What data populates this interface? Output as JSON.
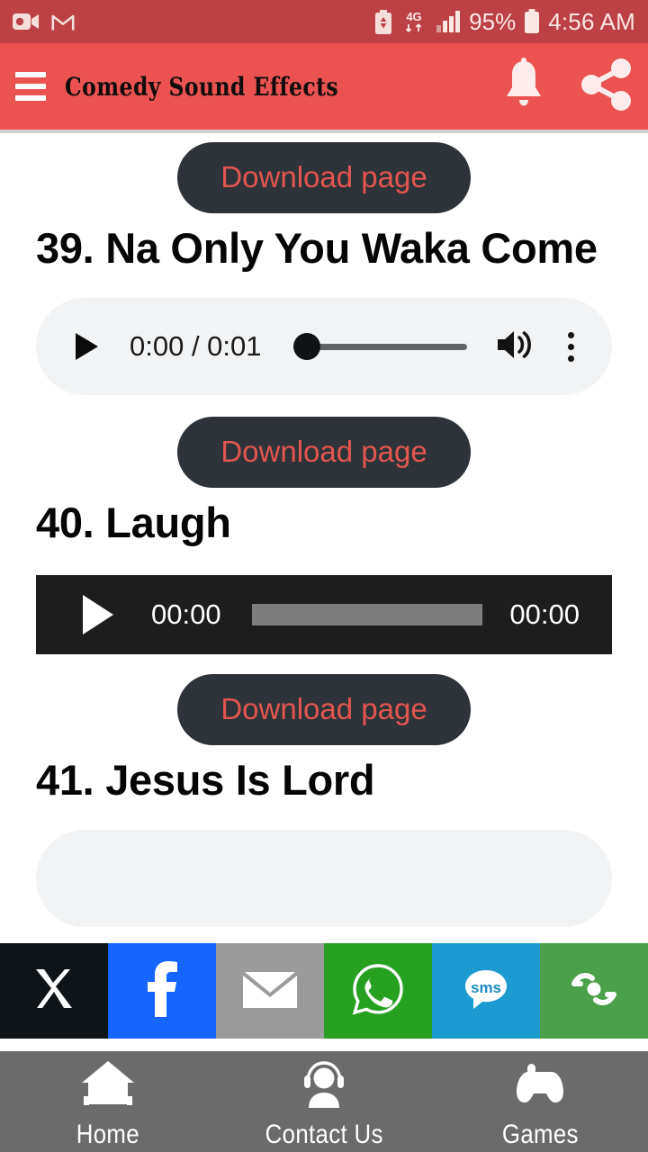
{
  "status_bar": {
    "background": "#bd4144",
    "left_icons": [
      "screen-recorder-icon",
      "gmail-icon"
    ],
    "battery_saver_icon": "battery-saver-icon",
    "network_type": "4G",
    "signal_icon": "signal-bars-icon",
    "battery_percent": "95%",
    "battery_icon": "battery-icon",
    "time": "4:56 AM"
  },
  "app_bar": {
    "background": "#ea5350",
    "menu_icon": "hamburger-menu-icon",
    "title": "Comedy Sound Effects",
    "notification_icon": "bell-icon",
    "share_icon": "share-icon"
  },
  "content": {
    "download_label": "Download page",
    "blocks": [
      {
        "download_label": "Download page",
        "title": "39. Na Only You Waka Come",
        "player": {
          "style": "light",
          "current_time": "0:00",
          "separator": "/",
          "duration": "0:01",
          "time_display": "0:00 / 0:01",
          "progress_percent": 0,
          "play_icon": "play-icon",
          "volume_icon": "volume-icon",
          "menu_icon": "more-vertical-icon"
        }
      },
      {
        "download_label": "Download page",
        "title": "40. Laugh",
        "player": {
          "style": "dark",
          "current_time": "00:00",
          "duration": "00:00",
          "progress_percent": 0,
          "play_icon": "play-icon"
        }
      },
      {
        "download_label": "Download page",
        "title": "41. Jesus Is Lord",
        "player": {
          "style": "light-cut-off"
        }
      }
    ]
  },
  "share_bar": [
    {
      "name": "x-twitter",
      "icon": "x-twitter-icon",
      "color": "#0f1419"
    },
    {
      "name": "facebook",
      "icon": "facebook-icon",
      "color": "#1566ff"
    },
    {
      "name": "email",
      "icon": "email-icon",
      "color": "#9b9b9b"
    },
    {
      "name": "whatsapp",
      "icon": "whatsapp-icon",
      "color": "#27a022"
    },
    {
      "name": "sms",
      "icon": "sms-icon",
      "color": "#1d9bd1"
    },
    {
      "name": "more-share",
      "icon": "addtoany-share-icon",
      "color": "#4aa14a"
    }
  ],
  "bottom_nav": {
    "background": "#6b6b6b",
    "items": [
      {
        "label": "Home",
        "icon": "home-icon"
      },
      {
        "label": "Contact Us",
        "icon": "headset-support-icon"
      },
      {
        "label": "Games",
        "icon": "gamepad-icon"
      }
    ]
  }
}
